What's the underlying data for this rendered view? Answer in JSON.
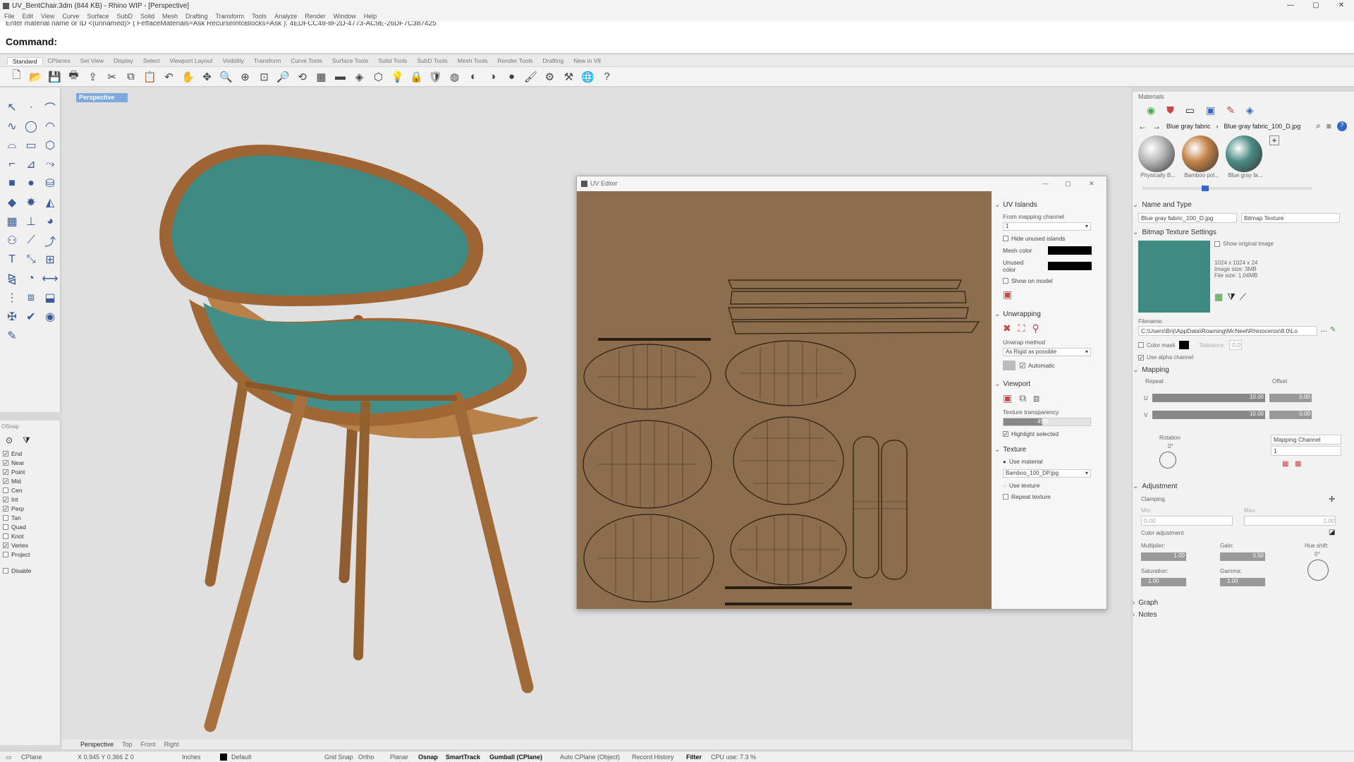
{
  "window": {
    "title": "UV_BentChair.3dm (844 KB) - Rhino WIP - [Perspective]",
    "controls": [
      "—",
      "▢",
      "✕"
    ]
  },
  "menu": [
    "File",
    "Edit",
    "View",
    "Curve",
    "Surface",
    "SubD",
    "Solid",
    "Mesh",
    "Drafting",
    "Transform",
    "Tools",
    "Analyze",
    "Render",
    "Window",
    "Help"
  ],
  "command": {
    "history": "Enter material name or ID <(unnamed)> ( FeffaceMaterials=Ask  RecurseIntoBlocks=Ask ): 4EDFCC48-8F2D-4773-AC9E-26DF7C387425",
    "label": "Command:"
  },
  "tabs": [
    "Standard",
    "CPlanes",
    "Set View",
    "Display",
    "Select",
    "Viewport Layout",
    "Visibility",
    "Transform",
    "Curve Tools",
    "Surface Tools",
    "Solid Tools",
    "SubD Tools",
    "Mesh Tools",
    "Render Tools",
    "Drafting",
    "New in V8"
  ],
  "toolbar_icons": [
    "new-icon",
    "open-icon",
    "save-icon",
    "print-icon",
    "import-icon",
    "cut-icon",
    "copy-icon",
    "paste-icon",
    "undo-icon",
    "pan-icon",
    "rotate-view-icon",
    "zoom-icon",
    "zoom-window-icon",
    "zoom-extents-icon",
    "zoom-selected-icon",
    "undo-view-icon",
    "four-view-icon",
    "properties-icon",
    "grid-icon",
    "ghost-icon",
    "light-icon",
    "lock-icon",
    "shield-icon",
    "color-wheel-icon",
    "sphere-icon",
    "render-sphere-icon",
    "blue-sphere-icon",
    "brush-icon",
    "gear-icon",
    "tools-icon",
    "globe-icon",
    "help-icon"
  ],
  "toolbar_glyphs": [
    "🗋",
    "📂",
    "💾",
    "🖶",
    "⇪",
    "✂",
    "⧉",
    "📋",
    "↶",
    "✋",
    "✥",
    "🔍",
    "⊕",
    "⊡",
    "🔎",
    "⟲",
    "▦",
    "▬",
    "◈",
    "⬡",
    "💡",
    "🔒",
    "🛡",
    "◍",
    "◐",
    "◑",
    "●",
    "🖌",
    "⚙",
    "⚒",
    "🌐",
    "?"
  ],
  "viewport": {
    "name": "Perspective"
  },
  "osnap": {
    "header": "OSnap",
    "items": [
      {
        "label": "End",
        "checked": true
      },
      {
        "label": "Near",
        "checked": true
      },
      {
        "label": "Point",
        "checked": true
      },
      {
        "label": "Mid",
        "checked": true
      },
      {
        "label": "Cen",
        "checked": false
      },
      {
        "label": "Int",
        "checked": true
      },
      {
        "label": "Perp",
        "checked": true
      },
      {
        "label": "Tan",
        "checked": false
      },
      {
        "label": "Quad",
        "checked": false
      },
      {
        "label": "Knot",
        "checked": false
      },
      {
        "label": "Vertex",
        "checked": true
      },
      {
        "label": "Project",
        "checked": false
      }
    ],
    "disable": "Disable"
  },
  "uv_editor": {
    "title": "UV Editor",
    "islands": {
      "header": "UV Islands",
      "from_label": "From mapping channel",
      "from_value": "1",
      "hide_unused": "Hide unused islands",
      "mesh_color": "Mesh color",
      "unused_color": "Unused color",
      "show_on_model": "Show on model"
    },
    "unwrapping": {
      "header": "Unwrapping",
      "method_label": "Unwrap method",
      "method_value": "As Rigid as possible",
      "automatic": "Automatic"
    },
    "viewport": {
      "header": "Viewport",
      "transparency_label": "Texture transparency",
      "transparency_value": "45%",
      "transparency": 0.45,
      "highlight": "Highlight selected"
    },
    "texture": {
      "header": "Texture",
      "use_material": "Use material",
      "file": "Bamboo_100_DP.jpg",
      "use_texture": "Use texture",
      "repeat_texture": "Repeat texture"
    }
  },
  "materials": {
    "header": "Materials",
    "breadcrumb": [
      "Blue gray fabric",
      "Blue gray fabric_100_D.jpg"
    ],
    "thumbs": [
      {
        "label": "Physically B...",
        "color": "#b8b8b8"
      },
      {
        "label": "Bamboo pol...",
        "color": "#c4844a"
      },
      {
        "label": "Blue gray fa...",
        "color": "#4d8c86"
      }
    ],
    "name_type": {
      "header": "Name and Type",
      "name": "Blue gray fabric_100_D.jpg",
      "type": "Bitmap Texture"
    },
    "bitmap": {
      "header": "Bitmap Texture Settings",
      "show_original": "Show original image",
      "info": [
        "1024 x 1024 x 24",
        "Image size: 3MB",
        "File size: 1.04MB"
      ],
      "filename_label": "Filename:",
      "filename": "C:\\Users\\Brij\\AppData\\Roaming\\McNeel\\Rhinoceros\\8.0\\Lo",
      "color_mask": "Color mask",
      "tolerance": "Tolerance:",
      "tolerance_value": "0.0",
      "alpha": "Use alpha channel"
    },
    "mapping": {
      "header": "Mapping",
      "repeat": "Repeat",
      "offset": "Offset",
      "u": "U",
      "v": "V",
      "repeat_u": "10.00",
      "repeat_v": "10.00",
      "offset_u": "0.00",
      "offset_v": "0.00",
      "rotation": "Rotation",
      "rotation_value": "0°",
      "mapping_channel": "Mapping Channel",
      "channel_value": "1"
    },
    "adjustment": {
      "header": "Adjustment",
      "clamping": "Clamping",
      "min": "Min:",
      "max": "Max:",
      "min_value": "0.00",
      "max_value": "1.00",
      "color_adjustment": "Color adjustment",
      "multiplier": "Multiplier:",
      "multiplier_value": "1.00",
      "gain": "Gain:",
      "gain_value": "0.50",
      "hue_shift": "Hue shift:",
      "hue_value": "0°",
      "saturation": "Saturation:",
      "saturation_value": "1.00",
      "gamma": "Gamma:",
      "gamma_value": "1.00"
    },
    "graph": "Graph",
    "notes": "Notes"
  },
  "viewport_tabs": [
    "Perspective",
    "Top",
    "Front",
    "Right"
  ],
  "status": {
    "cplane": "CPlane",
    "coords": "X 0.945  Y 0.366  Z 0",
    "units": "Inches",
    "layer": "Default",
    "items": [
      "Grid Snap",
      "Ortho",
      "Planar",
      "Osnap",
      "SmartTrack",
      "Gumball (CPlane)",
      "Auto CPlane (Object)",
      "Record History",
      "Filter"
    ],
    "cpu": "CPU use: 7.3 %"
  },
  "colors": {
    "seat": "#3f8a82",
    "wood": "#a8703d",
    "uv_bg": "#8c6d4d",
    "viewport_tab": "#7da9df"
  }
}
